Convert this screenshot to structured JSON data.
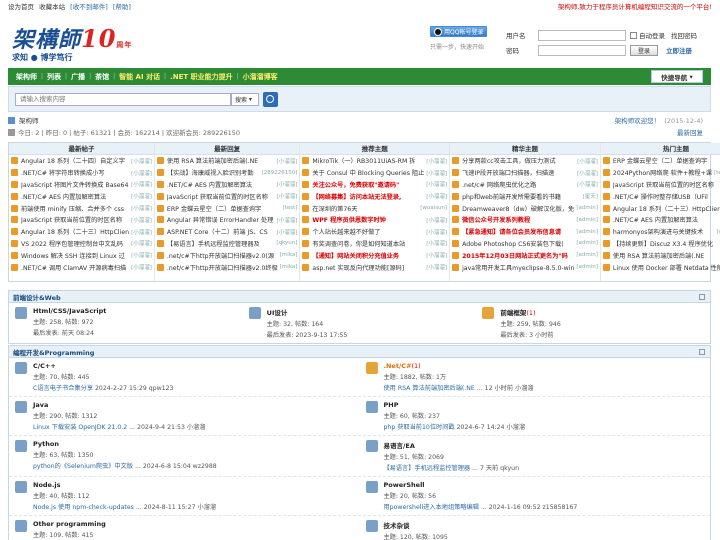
{
  "topbar": {
    "links": [
      "设为首页",
      "收藏本站",
      "[收不到邮件]",
      "[帮助]"
    ],
    "slogan": "架构师,致力于程序员计算机编程知识交流的一个平台!"
  },
  "logo": {
    "name": "架構師",
    "ten": "10",
    "anniv": "周年",
    "slogan": "求知 ● 博学笃行"
  },
  "qq": {
    "button": "用QQ帐号登录",
    "tip": "只需一步，快速开始"
  },
  "login": {
    "user_label": "用户名",
    "pass_label": "密码",
    "auto_login": "自动登录",
    "find_pass": "找回密码",
    "login_btn": "登录",
    "register": "立即注册"
  },
  "nav": {
    "items": [
      "架构师",
      "列表",
      "广播",
      "茶馆",
      "智能 AI 对话",
      ".NET 职业能力提升",
      "小溜溜博客"
    ],
    "quick": "快捷导航"
  },
  "search": {
    "placeholder": "请输入搜索内容",
    "type": "搜索"
  },
  "crumb": {
    "current": "架构师",
    "right": "架构师欢迎您！",
    "date": "(2015-12-4)"
  },
  "stats": {
    "text": "今日: 2  |  昨日: 0  |  帖子: 61321  |  会员: 162214  |  欢迎新会员: 289226150",
    "right": "最新回复"
  },
  "board": [
    {
      "title": "最新帖子",
      "items": [
        {
          "t": "Angular 18 系列（二十四）自定义字",
          "u": "[小溜溜]",
          "red": false
        },
        {
          "t": ".NET/C# 将字符串转换成小写",
          "u": "[小溜溜]",
          "red": false
        },
        {
          "t": "JavaScript 将图片文件转换成 Base64",
          "u": "[小溜溜]",
          "red": false
        },
        {
          "t": ".NET/C# AES 内置加解密算法",
          "u": "[小溜溜]",
          "red": false
        },
        {
          "t": "前端使用 minify 压缩、合并多个 css",
          "u": "[小溜溜]",
          "red": false
        },
        {
          "t": "JavaScript 获取当前位置的时区名称",
          "u": "[小溜溜]",
          "red": false
        },
        {
          "t": "Angular 18 系列（二十三）HttpClien",
          "u": "[小溜溜]",
          "red": false
        },
        {
          "t": "VS 2022 程序包管理控制台中文乱码",
          "u": "[小溜溜]",
          "red": false
        },
        {
          "t": "Windows 解决 SSH 连接到 Linux 过",
          "u": "[小溜溜]",
          "red": false
        },
        {
          "t": ".NET/C# 调用 ClamAV 开源病毒扫描",
          "u": "[小溜溜]",
          "red": false
        }
      ]
    },
    {
      "title": "最新回复",
      "items": [
        {
          "t": "使用 RSA 算法前端加密后端(.NE",
          "u": "[小溜溜]",
          "red": false
        },
        {
          "t": "【实战】海康威视入脸识别考勤",
          "u": "[289226150]",
          "red": false
        },
        {
          "t": ".NET/C# AES 内置加解密算法",
          "u": "[小溜溜]",
          "red": false
        },
        {
          "t": "JavaScript 获取当前位置的时区名称",
          "u": "[小溜溜]",
          "red": false
        },
        {
          "t": "ERP 金蝶云星空（二）单据查询字",
          "u": "[test]",
          "red": false
        },
        {
          "t": "Angular 异常错误 ErrorHandler 处理",
          "u": "[小溜溜]",
          "red": false
        },
        {
          "t": "ASP.NET Core（十二）前端 JS、CS",
          "u": "[小溜溜]",
          "red": false
        },
        {
          "t": "【易语言】手机远程监控管理器及",
          "u": "[qkyun]",
          "red": false
        },
        {
          "t": ".net/c#下http开放端口扫描器v2.0(源",
          "u": "[mika]",
          "red": false
        },
        {
          "t": ".net/c#下http开放端口扫描器v2.0终极",
          "u": "[mika]",
          "red": false
        }
      ]
    },
    {
      "title": "推荐主题",
      "items": [
        {
          "t": "MikroTik（一）RB3011UiAS-RM 拆",
          "u": "[小溜溜]",
          "red": false
        },
        {
          "t": "关于 Consul 中 Blocking Queries 阻止",
          "u": "[小溜溜]",
          "red": false
        },
        {
          "t": "关注公众号，免费获取\"邀请码\"",
          "u": "[小溜溜]",
          "red": true
        },
        {
          "t": "【网络募集】访问本站无法登录,",
          "u": "[小溜溜]",
          "red": true
        },
        {
          "t": "在深圳的第76天",
          "u": "[woaisun]",
          "red": false
        },
        {
          "t": "WPF 程序员供恩数字时钟",
          "u": "[小溜溜]",
          "red": true
        },
        {
          "t": "个人站长越来越不好做了",
          "u": "[小溜溜]",
          "red": false
        },
        {
          "t": "有奖调查问卷，你是如何知道本站",
          "u": "[小溜溜]",
          "red": false
        },
        {
          "t": "【通知】网站关闭积分充值业务",
          "u": "[小溜溜]",
          "red": true
        },
        {
          "t": "asp.net 实现反向代理功能[源码]",
          "u": "[小溜溜]",
          "red": false
        }
      ]
    },
    {
      "title": "精华主题",
      "items": [
        {
          "t": "分享两款cc攻击工具，做压力测试",
          "u": "[小溜溜]",
          "red": false
        },
        {
          "t": "飞速IP段开放端口扫描器，扫描速",
          "u": "[小溜溜]",
          "red": false
        },
        {
          "t": ".net/c# 网络爬虫优化之路",
          "u": "[小溜溜]",
          "red": false
        },
        {
          "t": "php和web前端开发所需要看的书籍",
          "u": "[星天]",
          "red": false
        },
        {
          "t": "Dreamweaver8（dw）破解汉化版，免",
          "u": "[admin]",
          "red": false
        },
        {
          "t": "微信公众号开发系列教程",
          "u": "[admin]",
          "red": true
        },
        {
          "t": "【紧急通知】请各位会员发布信息请",
          "u": "[admin]",
          "red": true
        },
        {
          "t": "Adobe Photoshop CS6安装包下载(",
          "u": "[admin]",
          "red": false
        },
        {
          "t": "2015年12月03日网站正式更名为\"码",
          "u": "[admin]",
          "red": true
        },
        {
          "t": "java常用开发工具myeclipse-8.5.0-win",
          "u": "[admin]",
          "red": false
        }
      ]
    },
    {
      "title": "热门主题",
      "items": [
        {
          "t": "ERP 金蝶云星空（二）单据查询字",
          "u": "[test]",
          "red": false
        },
        {
          "t": "2024Python网络爬 软件+教程+课",
          "u": "[technqiang]",
          "red": false
        },
        {
          "t": "JavaScript 获取当前位置的时区名称",
          "u": "[小溜溜]",
          "red": false
        },
        {
          "t": ".NET/C# 操作时整存储USB（UFil",
          "u": "[小溜溜]",
          "red": false
        },
        {
          "t": "Angular 18 系列（二十三）HttpClien",
          "u": "[小溜溜]",
          "red": false
        },
        {
          "t": ".NET/C# AES 内置加解密算法",
          "u": "[小溜溜]",
          "red": false
        },
        {
          "t": "harmonyos架构演进与关键技术",
          "u": "[wuyuyang]",
          "red": false
        },
        {
          "t": "【持续更新】Discuz X3.4 程序优化",
          "u": "[小溜溜]",
          "red": false
        },
        {
          "t": "使用 RSA 算法前端加密后端(.NE",
          "u": "[小溜溜]",
          "red": false
        },
        {
          "t": "Linux 使用 Docker 部署 Netdata 性能",
          "u": "[小溜溜]",
          "red": false
        }
      ]
    }
  ],
  "sections": [
    {
      "title": "前端设计&Web",
      "rows": [
        [
          {
            "name": "Html/CSS/JavaScript",
            "today": "",
            "stats": "主题: 258, 帖数: 972",
            "last": "最后发表: 前天 08:24",
            "lt": ""
          },
          {
            "name": "UI设计",
            "today": "",
            "stats": "主题: 32, 帖数: 164",
            "last": "最后发表: 2023-9-13 17:55",
            "lt": ""
          },
          {
            "name": "前端框架",
            "today": "(1)",
            "stats": "主题: 259, 帖数: 946",
            "last": "最后发表: 3 小时前",
            "lt": ""
          }
        ]
      ]
    },
    {
      "title": "编程开发&Programming",
      "rows": [
        [
          {
            "name": "C/C++",
            "today": "",
            "stats": "主题: 70, 帖数: 445",
            "last": " 2024-2-27 15:29 qpw123",
            "lt": "C语言电子书合集分享"
          },
          {
            "name": ".Net/C#",
            "today": "(1)",
            "stats": "主题: 1882, 帖数: 1万",
            "last": " ... 12 小时前 小溜溜",
            "lt": "使用 RSA 算法前端加密后端(.NE",
            "orange": true
          }
        ],
        [
          {
            "name": "Java",
            "today": "",
            "stats": "主题: 290, 帖数: 1312",
            "last": " 2024-9-4 21:53 小溜溜",
            "lt": "Linux 下载安装 OpenJDK 21.0.2 ..."
          },
          {
            "name": "PHP",
            "today": "",
            "stats": "主题: 60, 帖数: 237",
            "last": " 2024-6-7 14:24 小溜溜",
            "lt": "php 获取当前10位时间戳"
          }
        ],
        [
          {
            "name": "Python",
            "today": "",
            "stats": "主题: 63, 帖数: 1350",
            "last": " ... 2024-6-8 15:04 wz2988",
            "lt": "python的《Selenium爬虫》中文版"
          },
          {
            "name": "易语言/EA",
            "today": "",
            "stats": "主题: 51, 帖数: 2069",
            "last": " ... 7 天前 qkyun",
            "lt": "【易语言】手机远程监控管理器"
          }
        ],
        [
          {
            "name": "Node.js",
            "today": "",
            "stats": "主题: 40, 帖数: 112",
            "last": " ... 2024-8-11 15:27 小溜溜",
            "lt": "Node.js 使用 npm-check-updates"
          },
          {
            "name": "PowerShell",
            "today": "",
            "stats": "主题: 20, 帖数: 56",
            "last": " ... 2024-1-16 09:52 z15858167",
            "lt": "用powershell进入本地组策略编辑"
          }
        ],
        [
          {
            "name": "Other programming",
            "today": "",
            "stats": "主题: 109, 帖数: 415",
            "last": "",
            "lt": ""
          },
          {
            "name": "技术杂谈",
            "today": "",
            "stats": "主题: 120, 帖数: 1095",
            "last": "",
            "lt": ""
          }
        ]
      ]
    }
  ]
}
